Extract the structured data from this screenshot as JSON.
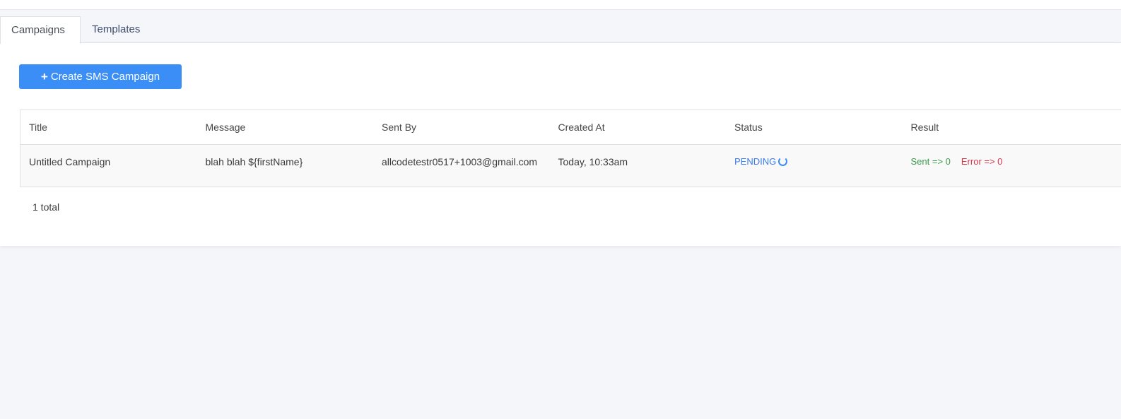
{
  "tabs": [
    {
      "label": "Campaigns",
      "active": true
    },
    {
      "label": "Templates",
      "active": false
    }
  ],
  "toolbar": {
    "create_label": "Create SMS Campaign",
    "create_icon": "plus-icon",
    "accent_color": "#3a8ef6"
  },
  "table": {
    "columns": [
      "Title",
      "Message",
      "Sent By",
      "Created At",
      "Status",
      "Result"
    ],
    "rows": [
      {
        "title": "Untitled Campaign",
        "message": "blah blah ${firstName}",
        "sent_by": "allcodetestr0517+1003@gmail.com",
        "created_at": "Today, 10:33am",
        "status": "PENDING",
        "status_icon": "spinner-icon",
        "sent": "Sent => 0",
        "error": "Error => 0"
      }
    ]
  },
  "pagination": {
    "total_label": "1 total"
  },
  "colors": {
    "pending": "#3a7bf0",
    "sent": "#3a9a4a",
    "error": "#d9334a"
  }
}
